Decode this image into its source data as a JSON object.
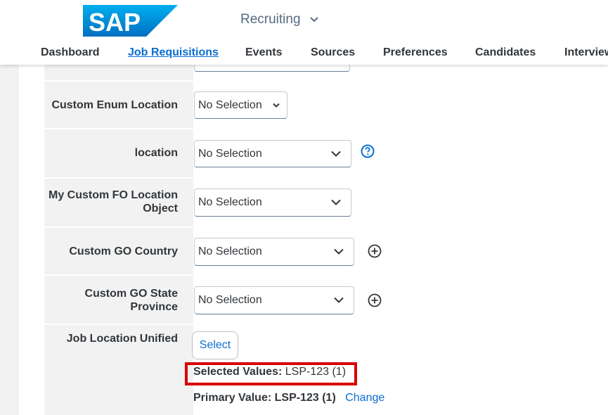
{
  "header": {
    "logo_text": "SAP",
    "module_label": "Recruiting",
    "nav": [
      "Dashboard",
      "Job Requisitions",
      "Events",
      "Sources",
      "Preferences",
      "Candidates",
      "Interview"
    ],
    "active_nav": "Job Requisitions"
  },
  "form": {
    "fields": [
      {
        "label": "Custom Enum Location",
        "value": "No Selection"
      },
      {
        "label": "location",
        "value": "No Selection"
      },
      {
        "label_line1": "My Custom FO Location",
        "label_line2": "Object",
        "value": "No Selection"
      },
      {
        "label": "Custom GO Country",
        "value": "No Selection"
      },
      {
        "label_line1": "Custom GO State",
        "label_line2": "Province",
        "value": "No Selection"
      },
      {
        "label": "Job Location Unified"
      }
    ],
    "select_button": "Select",
    "selected_values_label": "Selected Values:",
    "selected_values_value": "LSP-123 (1)",
    "primary_value_label": "Primary Value:",
    "primary_value_value": "LSP-123 (1)",
    "change_link": "Change"
  },
  "colors": {
    "accent": "#0a6ed1",
    "highlight": "#d90000",
    "label_bg": "#f2f2f2"
  }
}
